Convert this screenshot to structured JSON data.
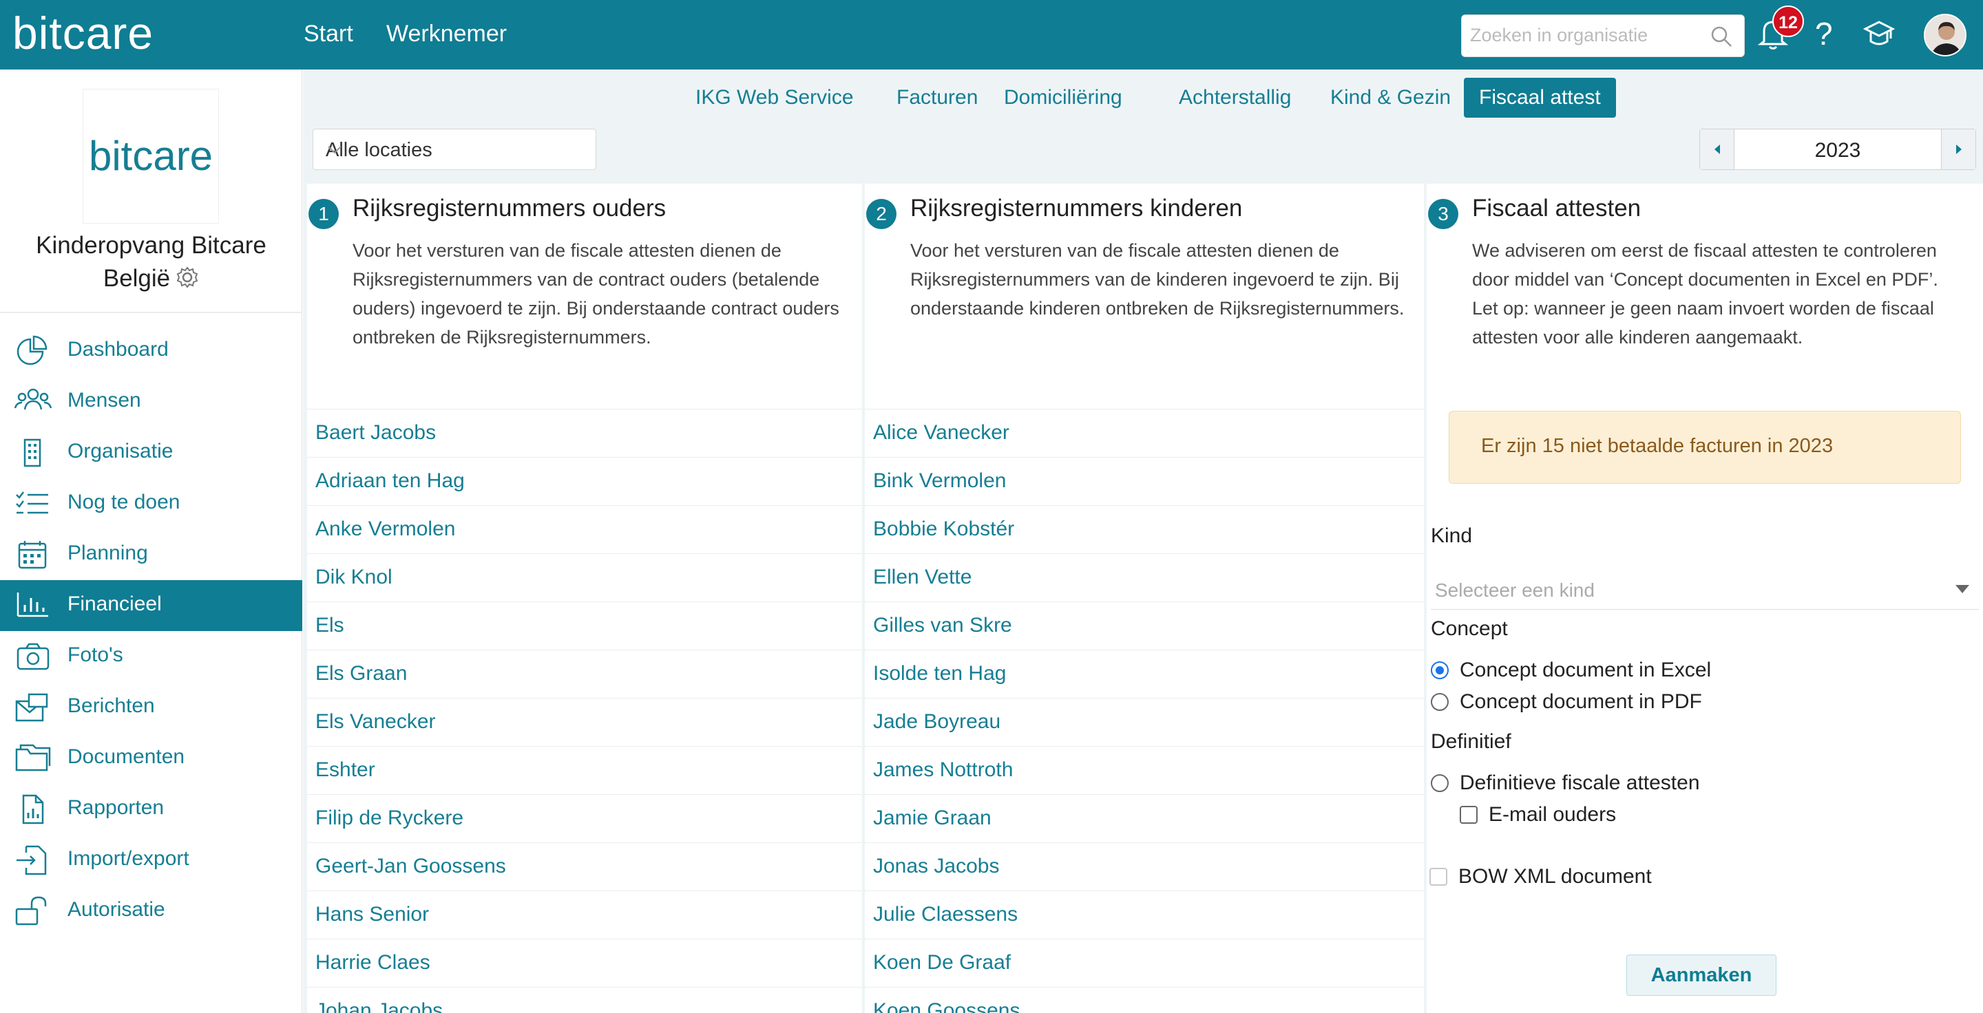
{
  "app": {
    "logo": "bitcare",
    "nav": [
      "Start",
      "Werknemer"
    ],
    "search_placeholder": "Zoeken in organisatie",
    "notification_count": "12",
    "help_label": "?"
  },
  "sidebar": {
    "org_logo": "bitcare",
    "org_name_line1": "Kinderopvang Bitcare",
    "org_name_line2": "België",
    "items": [
      {
        "label": "Dashboard",
        "icon": "pie-chart-icon"
      },
      {
        "label": "Mensen",
        "icon": "people-icon"
      },
      {
        "label": "Organisatie",
        "icon": "building-icon"
      },
      {
        "label": "Nog te doen",
        "icon": "checklist-icon"
      },
      {
        "label": "Planning",
        "icon": "calendar-icon"
      },
      {
        "label": "Financieel",
        "icon": "bar-chart-icon",
        "active": true
      },
      {
        "label": "Foto's",
        "icon": "camera-icon"
      },
      {
        "label": "Berichten",
        "icon": "mail-icon"
      },
      {
        "label": "Documenten",
        "icon": "folder-icon"
      },
      {
        "label": "Rapporten",
        "icon": "report-icon"
      },
      {
        "label": "Import/export",
        "icon": "import-export-icon"
      },
      {
        "label": "Autorisatie",
        "icon": "unlock-icon"
      }
    ]
  },
  "tabs": [
    {
      "label": "IKG Web Service"
    },
    {
      "label": "Facturen"
    },
    {
      "label": "Domiciliëring"
    },
    {
      "label": "Achterstallig"
    },
    {
      "label": "Kind & Gezin"
    },
    {
      "label": "Fiscaal attest",
      "active": true
    }
  ],
  "filters": {
    "location": "Alle locaties",
    "year": "2023"
  },
  "step1": {
    "num": "1",
    "title": "Rijksregisternummers ouders",
    "text": "Voor het versturen van de fiscale attesten dienen de Rijksregisternummers van de contract ouders (betalende ouders) ingevoerd te zijn. Bij onderstaande contract ouders ontbreken de Rijksregisternummers.",
    "names": [
      "Baert Jacobs",
      "Adriaan ten Hag",
      "Anke Vermolen",
      "Dik Knol",
      "Els",
      "Els Graan",
      "Els Vanecker",
      "Eshter",
      "Filip de Ryckere",
      "Geert-Jan Goossens",
      "Hans Senior",
      "Harrie Claes",
      "Johan Jacobs"
    ]
  },
  "step2": {
    "num": "2",
    "title": "Rijksregisternummers kinderen",
    "text": "Voor het versturen van de fiscale attesten dienen de Rijksregisternummers van de kinderen ingevoerd te zijn. Bij onderstaande kinderen ontbreken de Rijksregisternummers.",
    "names": [
      "Alice Vanecker",
      "Bink Vermolen",
      "Bobbie Kobstér",
      "Ellen Vette",
      "Gilles van Skre",
      "Isolde ten Hag",
      "Jade Boyreau",
      "James Nottroth",
      "Jamie Graan",
      "Jonas Jacobs",
      "Julie Claessens",
      "Koen De Graaf",
      "Koen Goossens"
    ]
  },
  "step3": {
    "num": "3",
    "title": "Fiscaal attesten",
    "text": "We adviseren om eerst de fiscaal attesten te controleren door middel van ‘Concept documenten in Excel en PDF’. Let op: wanneer je geen naam invoert worden de fiscaal attesten voor alle kinderen aangemaakt.",
    "alert": "Er zijn 15 niet betaalde facturen in 2023",
    "kind_label": "Kind",
    "kind_placeholder": "Selecteer een kind",
    "concept_label": "Concept",
    "concept_excel": "Concept document in Excel",
    "concept_pdf": "Concept document in PDF",
    "definitief_label": "Definitief",
    "definitief_option": "Definitieve fiscale attesten",
    "email_parents": "E-mail ouders",
    "bow_xml": "BOW XML document",
    "submit": "Aanmaken"
  },
  "colors": {
    "brand": "#0f7d93",
    "link": "#167e93",
    "alert_bg": "#fcefd6",
    "badge": "#d10f1f"
  }
}
